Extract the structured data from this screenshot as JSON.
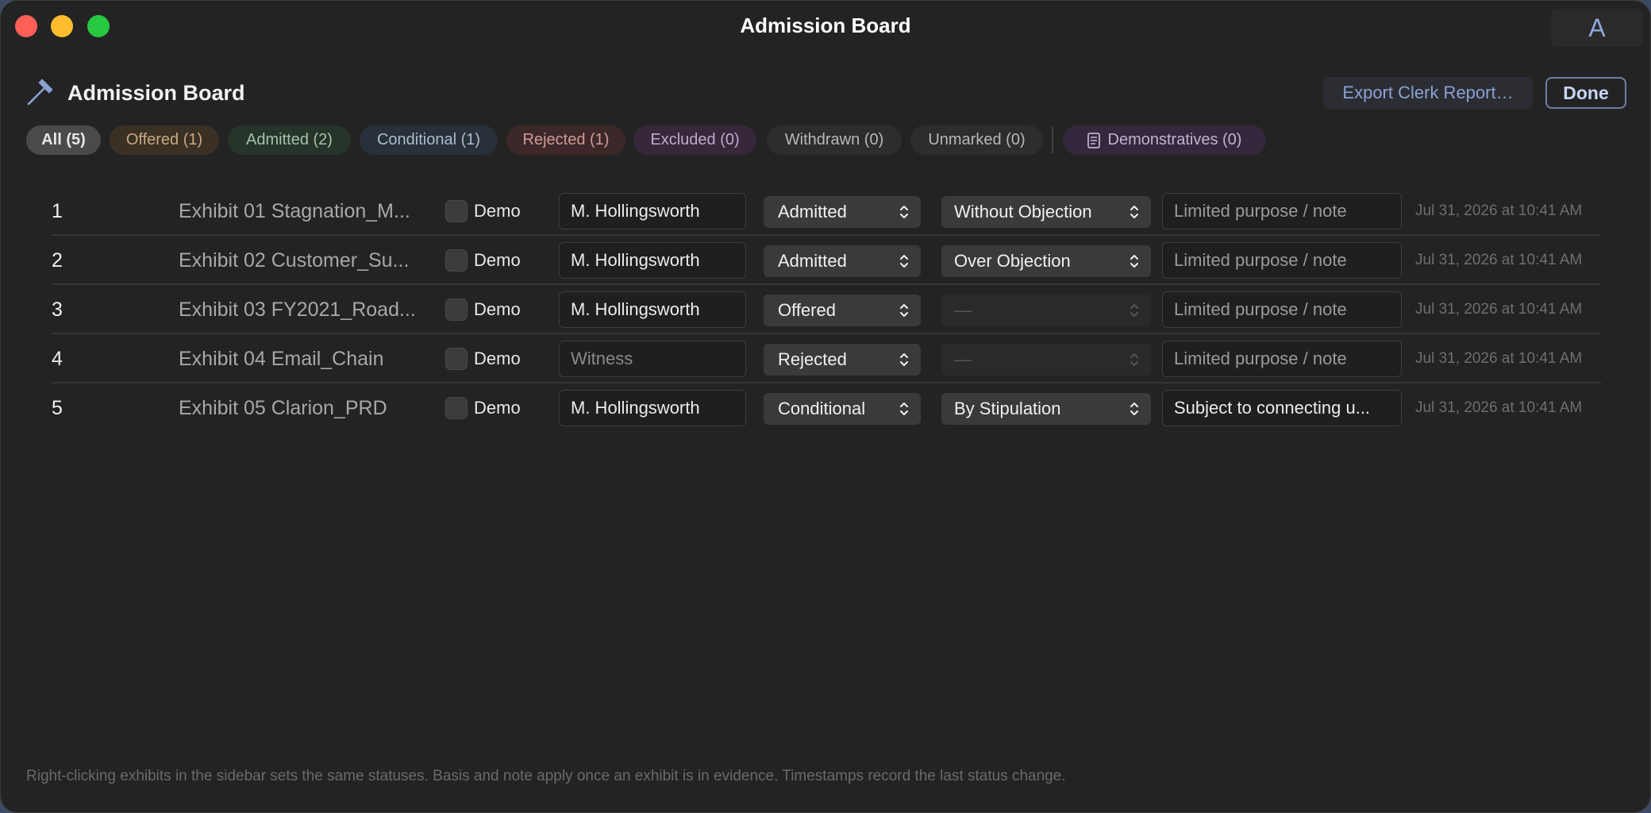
{
  "window": {
    "title": "Admission Board",
    "account_initial": "A"
  },
  "header": {
    "title": "Admission Board",
    "export_label": "Export Clerk Report…",
    "done_label": "Done"
  },
  "filters": {
    "all": "All (5)",
    "offered": "Offered (1)",
    "admitted": "Admitted (2)",
    "conditional": "Conditional (1)",
    "rejected": "Rejected (1)",
    "excluded": "Excluded (0)",
    "withdrawn": "Withdrawn (0)",
    "unmarked": "Unmarked (0)",
    "demonstratives": "Demonstratives (0)"
  },
  "rows": [
    {
      "num": "1",
      "name": "Exhibit 01 Stagnation_M...",
      "demo": "Demo",
      "witness": "M. Hollingsworth",
      "status": "Admitted",
      "basis": "Without Objection",
      "note": "Limited purpose / note",
      "timestamp": "Jul 31, 2026 at 10:41 AM"
    },
    {
      "num": "2",
      "name": "Exhibit 02 Customer_Su...",
      "demo": "Demo",
      "witness": "M. Hollingsworth",
      "status": "Admitted",
      "basis": "Over Objection",
      "note": "Limited purpose / note",
      "timestamp": "Jul 31, 2026 at 10:41 AM"
    },
    {
      "num": "3",
      "name": "Exhibit 03 FY2021_Road...",
      "demo": "Demo",
      "witness": "M. Hollingsworth",
      "status": "Offered",
      "basis": "—",
      "note": "Limited purpose / note",
      "timestamp": "Jul 31, 2026 at 10:41 AM"
    },
    {
      "num": "4",
      "name": "Exhibit 04 Email_Chain",
      "demo": "Demo",
      "witness": "Witness",
      "status": "Rejected",
      "basis": "—",
      "note": "Limited purpose / note",
      "timestamp": "Jul 31, 2026 at 10:41 AM"
    },
    {
      "num": "5",
      "name": "Exhibit 05 Clarion_PRD",
      "demo": "Demo",
      "witness": "M. Hollingsworth",
      "status": "Conditional",
      "basis": "By Stipulation",
      "note": "Subject to connecting u...",
      "timestamp": "Jul 31, 2026 at 10:41 AM"
    }
  ],
  "footer": "Right-clicking exhibits in the sidebar sets the same statuses. Basis and note apply once an exhibit is in evidence. Timestamps record the last status change.",
  "colors": {
    "window_bg": "#232323",
    "accent": "#8aa2d4",
    "close": "#fe5f57",
    "minimize": "#febc2e",
    "maximize": "#28c840"
  }
}
